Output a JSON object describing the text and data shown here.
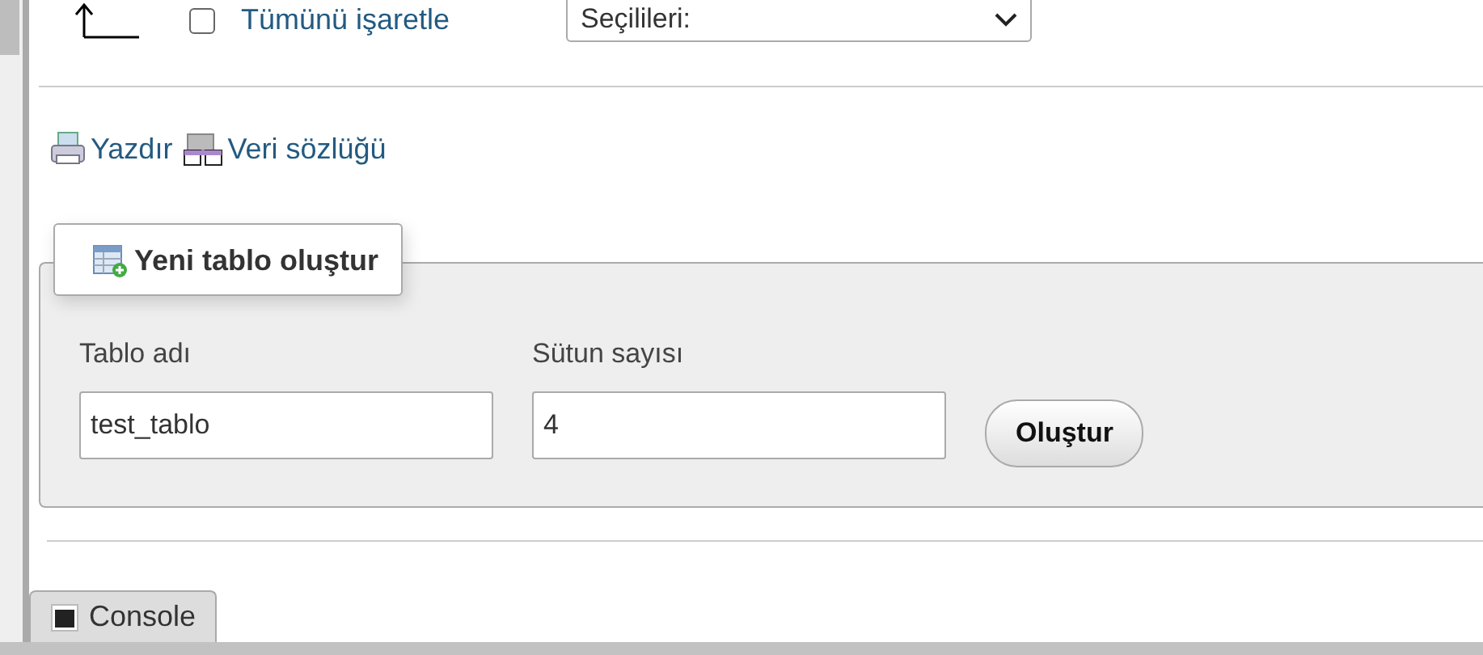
{
  "select_all": {
    "label": "Tümünü işaretle",
    "checked": false
  },
  "bulk_action": {
    "value": "Seçilileri:"
  },
  "links": [
    "Yazdır",
    "Veri sözlüğü"
  ],
  "create_table": {
    "legend": "Yeni tablo oluştur",
    "fields": [
      {
        "label": "Tablo adı",
        "value": "test_tablo"
      },
      {
        "label": "Sütun sayısı",
        "value": "4"
      }
    ],
    "button": "Oluştur"
  },
  "console": {
    "label": "Console"
  }
}
